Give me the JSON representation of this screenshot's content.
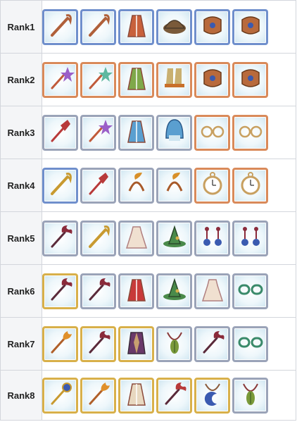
{
  "frame_colors": {
    "blue": "#6f8fcc",
    "copper": "#d98a5a",
    "silver": "#9aa3b8",
    "gold": "#d8b04a"
  },
  "rows": [
    {
      "label": "Rank1",
      "items": [
        {
          "icon": "staff-icon",
          "frame": "blue",
          "color": "#b0603a"
        },
        {
          "icon": "staff-icon",
          "frame": "blue",
          "color": "#b0603a"
        },
        {
          "icon": "robe-icon",
          "frame": "blue",
          "color": "#c8613c"
        },
        {
          "icon": "cap-icon",
          "frame": "blue",
          "color": "#7a5a3a"
        },
        {
          "icon": "bracer-icon",
          "frame": "blue",
          "color": "#b86a3c"
        },
        {
          "icon": "bracer-icon",
          "frame": "blue",
          "color": "#b86a3c"
        }
      ]
    },
    {
      "label": "Rank2",
      "items": [
        {
          "icon": "wand-icon",
          "frame": "copper",
          "color": "#9b5fc8"
        },
        {
          "icon": "wand-icon",
          "frame": "copper",
          "color": "#5fb8a0"
        },
        {
          "icon": "robe-icon",
          "frame": "copper",
          "color": "#7fa84a"
        },
        {
          "icon": "boots-icon",
          "frame": "copper",
          "color": "#c9b070"
        },
        {
          "icon": "bracer-icon",
          "frame": "copper",
          "color": "#b86a3c"
        },
        {
          "icon": "bracer-icon",
          "frame": "copper",
          "color": "#b86a3c"
        }
      ]
    },
    {
      "label": "Rank3",
      "items": [
        {
          "icon": "scepter-icon",
          "frame": "silver",
          "color": "#b83a3a"
        },
        {
          "icon": "wand-icon",
          "frame": "silver",
          "color": "#9b5fc8"
        },
        {
          "icon": "robe-icon",
          "frame": "silver",
          "color": "#5a9fd0"
        },
        {
          "icon": "hood-icon",
          "frame": "silver",
          "color": "#5a9fd0"
        },
        {
          "icon": "glasses-icon",
          "frame": "copper",
          "color": "#c8a060"
        },
        {
          "icon": "glasses-icon",
          "frame": "copper",
          "color": "#c8a060"
        }
      ]
    },
    {
      "label": "Rank4",
      "items": [
        {
          "icon": "staff-icon",
          "frame": "blue",
          "color": "#c89a30"
        },
        {
          "icon": "scepter-icon",
          "frame": "silver",
          "color": "#b83a3a"
        },
        {
          "icon": "horn-headband-icon",
          "frame": "silver",
          "color": "#d8902a"
        },
        {
          "icon": "horn-headband-icon",
          "frame": "silver",
          "color": "#d8902a"
        },
        {
          "icon": "pocket-watch-icon",
          "frame": "copper",
          "color": "#c8a060"
        },
        {
          "icon": "pocket-watch-icon",
          "frame": "copper",
          "color": "#c8a060"
        }
      ]
    },
    {
      "label": "Rank5",
      "items": [
        {
          "icon": "dark-staff-icon",
          "frame": "silver",
          "color": "#8a2a3a"
        },
        {
          "icon": "staff-icon",
          "frame": "silver",
          "color": "#c89a30"
        },
        {
          "icon": "dress-icon",
          "frame": "silver",
          "color": "#f0e0d0"
        },
        {
          "icon": "witch-hat-icon",
          "frame": "silver",
          "color": "#4a8a4a"
        },
        {
          "icon": "earrings-icon",
          "frame": "silver",
          "color": "#3a5ab0"
        },
        {
          "icon": "earrings-icon",
          "frame": "silver",
          "color": "#3a5ab0"
        }
      ]
    },
    {
      "label": "Rank6",
      "items": [
        {
          "icon": "dark-staff-icon",
          "frame": "gold",
          "color": "#8a2a3a"
        },
        {
          "icon": "dark-staff-icon",
          "frame": "silver",
          "color": "#8a2a3a"
        },
        {
          "icon": "robe-icon",
          "frame": "silver",
          "color": "#c83a3a"
        },
        {
          "icon": "witch-hat-icon",
          "frame": "silver",
          "color": "#4a8a4a"
        },
        {
          "icon": "dress-icon",
          "frame": "silver",
          "color": "#f0e0d0"
        },
        {
          "icon": "goggles-icon",
          "frame": "silver",
          "color": "#3a8a6a"
        }
      ]
    },
    {
      "label": "Rank7",
      "items": [
        {
          "icon": "flame-staff-icon",
          "frame": "gold",
          "color": "#e0902a"
        },
        {
          "icon": "dark-staff-icon",
          "frame": "gold",
          "color": "#8a2a3a"
        },
        {
          "icon": "coat-icon",
          "frame": "gold",
          "color": "#6a3a6a"
        },
        {
          "icon": "leaf-amulet-icon",
          "frame": "silver",
          "color": "#7a9a3a"
        },
        {
          "icon": "dark-staff-icon",
          "frame": "silver",
          "color": "#8a2a3a"
        },
        {
          "icon": "goggles-icon",
          "frame": "silver",
          "color": "#3a8a6a"
        }
      ]
    },
    {
      "label": "Rank8",
      "items": [
        {
          "icon": "ornate-staff-icon",
          "frame": "gold",
          "color": "#3a5ab0"
        },
        {
          "icon": "flame-staff-icon",
          "frame": "gold",
          "color": "#e0902a"
        },
        {
          "icon": "robe-icon",
          "frame": "gold",
          "color": "#e8d8c0"
        },
        {
          "icon": "dark-staff-icon",
          "frame": "gold",
          "color": "#b83a3a"
        },
        {
          "icon": "moon-amulet-icon",
          "frame": "gold",
          "color": "#3a5ab0"
        },
        {
          "icon": "leaf-amulet-icon",
          "frame": "silver",
          "color": "#7a9a3a"
        }
      ]
    }
  ]
}
